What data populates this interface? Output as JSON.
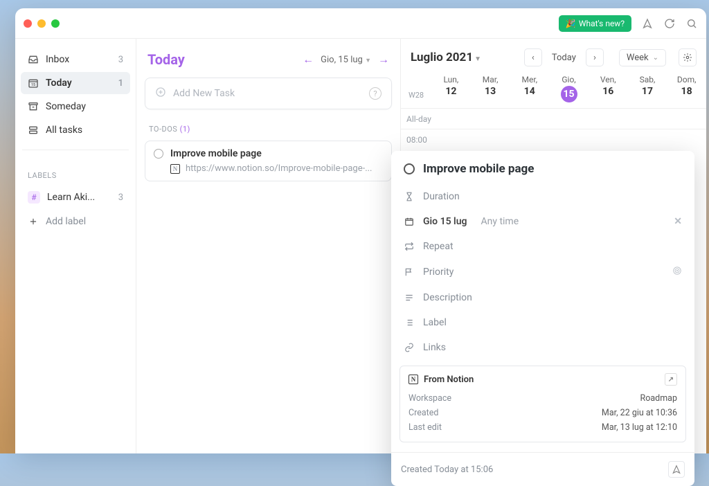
{
  "titlebar": {
    "whats_new": "What's new?"
  },
  "sidebar": {
    "items": [
      {
        "label": "Inbox",
        "count": "3"
      },
      {
        "label": "Today",
        "count": "1"
      },
      {
        "label": "Someday",
        "count": ""
      },
      {
        "label": "All tasks",
        "count": ""
      }
    ],
    "labels_header": "LABELS",
    "labels": [
      {
        "label": "Learn Aki...",
        "count": "3"
      }
    ],
    "add_label": "Add label"
  },
  "center": {
    "title": "Today",
    "date": "Gio, 15 lug",
    "add_task_placeholder": "Add New Task",
    "section_label": "TO-DOS",
    "section_count": "(1)",
    "task": {
      "title": "Improve mobile page",
      "url": "https://www.notion.so/Improve-mobile-page-..."
    }
  },
  "calendar": {
    "title": "Luglio 2021",
    "today_btn": "Today",
    "week_btn": "Week",
    "week_num": "W28",
    "days": [
      {
        "name": "Lun,",
        "num": "12"
      },
      {
        "name": "Mar,",
        "num": "13"
      },
      {
        "name": "Mer,",
        "num": "14"
      },
      {
        "name": "Gio,",
        "num": "15",
        "today": true
      },
      {
        "name": "Ven,",
        "num": "16"
      },
      {
        "name": "Sab,",
        "num": "17"
      },
      {
        "name": "Dom,",
        "num": "18"
      }
    ],
    "allday": "All-day",
    "time0": "08:00"
  },
  "panel": {
    "title": "Improve mobile page",
    "duration": "Duration",
    "date": "Gio 15 lug",
    "anytime": "Any time",
    "repeat": "Repeat",
    "priority": "Priority",
    "description": "Description",
    "label": "Label",
    "links": "Links",
    "notion": {
      "head": "From Notion",
      "workspace_k": "Workspace",
      "workspace_v": "Roadmap",
      "created_k": "Created",
      "created_v": "Mar, 22 giu at 10:36",
      "edit_k": "Last edit",
      "edit_v": "Mar, 13 lug at 12:10"
    },
    "footer": "Created Today at 15:06"
  }
}
